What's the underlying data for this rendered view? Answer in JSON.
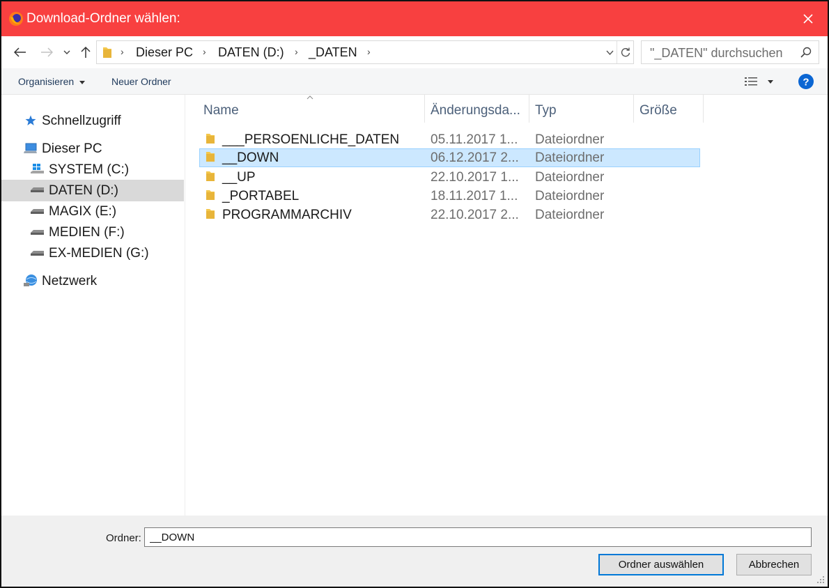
{
  "window": {
    "title": "Download-Ordner wählen:"
  },
  "address_bar": {
    "breadcrumbs": [
      "Dieser PC",
      "DATEN (D:)",
      "_DATEN"
    ]
  },
  "search": {
    "placeholder": "\"_DATEN\" durchsuchen"
  },
  "toolbar": {
    "organize_label": "Organisieren",
    "new_folder_label": "Neuer Ordner"
  },
  "sidebar": {
    "items": [
      {
        "label": "Schnellzugriff",
        "icon": "star-icon"
      },
      {
        "label": "Dieser PC",
        "icon": "computer-icon"
      },
      {
        "label": "SYSTEM (C:)",
        "icon": "windows-drive-icon"
      },
      {
        "label": "DATEN (D:)",
        "icon": "drive-icon",
        "selected": true
      },
      {
        "label": "MAGIX (E:)",
        "icon": "drive-icon"
      },
      {
        "label": "MEDIEN (F:)",
        "icon": "drive-icon"
      },
      {
        "label": "EX-MEDIEN (G:)",
        "icon": "drive-icon"
      },
      {
        "label": "Netzwerk",
        "icon": "network-icon"
      }
    ]
  },
  "file_list": {
    "columns": [
      "Name",
      "Änderungsda...",
      "Typ",
      "Größe"
    ],
    "rows": [
      {
        "name": "___PERSOENLICHE_DATEN",
        "date": "05.11.2017 1...",
        "type": "Dateiordner"
      },
      {
        "name": "__DOWN",
        "date": "06.12.2017 2...",
        "type": "Dateiordner",
        "selected": true
      },
      {
        "name": "__UP",
        "date": "22.10.2017 1...",
        "type": "Dateiordner"
      },
      {
        "name": "_PORTABEL",
        "date": "18.11.2017 1...",
        "type": "Dateiordner"
      },
      {
        "name": "PROGRAMMARCHIV",
        "date": "22.10.2017 2...",
        "type": "Dateiordner"
      }
    ]
  },
  "footer": {
    "folder_label": "Ordner:",
    "folder_value": "__DOWN",
    "select_button": "Ordner auswählen",
    "cancel_button": "Abbrechen"
  },
  "colors": {
    "titlebar": "#f84040",
    "selection": "#cce8ff",
    "sidebar_selection": "#d9d9d9",
    "folder": "#f4c84d",
    "help": "#0b66d3"
  }
}
